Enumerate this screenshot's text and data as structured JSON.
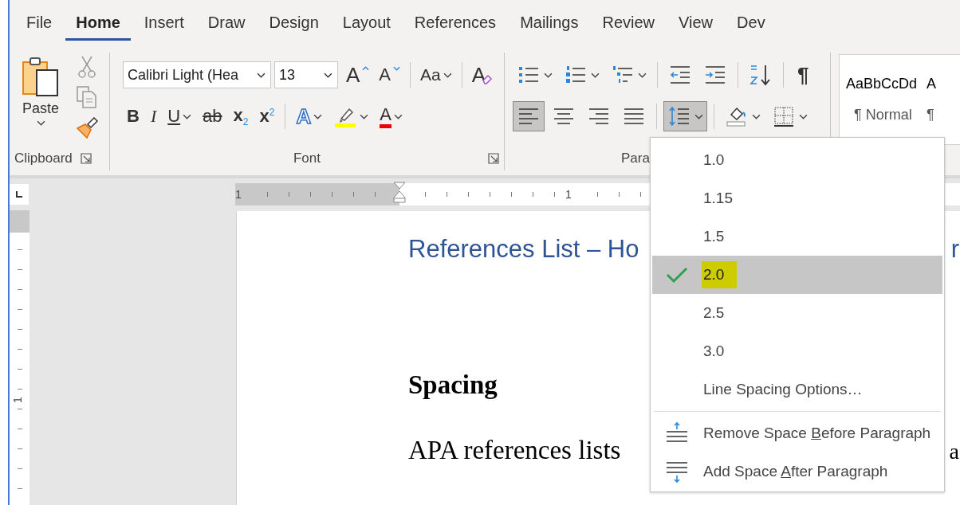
{
  "tabs": [
    {
      "label": "File",
      "selected": false
    },
    {
      "label": "Home",
      "selected": true
    },
    {
      "label": "Insert",
      "selected": false
    },
    {
      "label": "Draw",
      "selected": false
    },
    {
      "label": "Design",
      "selected": false
    },
    {
      "label": "Layout",
      "selected": false
    },
    {
      "label": "References",
      "selected": false
    },
    {
      "label": "Mailings",
      "selected": false
    },
    {
      "label": "Review",
      "selected": false
    },
    {
      "label": "View",
      "selected": false
    },
    {
      "label": "Dev",
      "selected": false
    }
  ],
  "clipboard": {
    "paste_label": "Paste",
    "group_label": "Clipboard"
  },
  "font": {
    "font_name": "Calibri Light (Hea",
    "font_size": "13",
    "group_label": "Font",
    "row1": [
      {
        "kind": "grow",
        "label": "A"
      },
      {
        "kind": "shrink",
        "label": "A"
      },
      {
        "kind": "case",
        "label": "Aa",
        "dropdown": true
      },
      {
        "kind": "clear",
        "label": "A"
      }
    ],
    "row2": [
      {
        "kind": "bold",
        "label": "B"
      },
      {
        "kind": "italic",
        "label": "I"
      },
      {
        "kind": "underline",
        "label": "U",
        "dropdown": true
      },
      {
        "kind": "strike",
        "label": "ab"
      },
      {
        "kind": "sub",
        "label": "x$_{2}$"
      },
      {
        "kind": "sup",
        "label": "x$^{2}$"
      },
      {
        "kind": "effects",
        "label": "A",
        "dropdown": true
      },
      {
        "kind": "highlight",
        "dropdown": true
      },
      {
        "kind": "color",
        "label": "A",
        "dropdown": true
      }
    ]
  },
  "paragraph": {
    "group_label": "Para",
    "row1": [
      {
        "kind": "bullets",
        "dropdown": true
      },
      {
        "kind": "numbering",
        "dropdown": true
      },
      {
        "kind": "multilevel",
        "dropdown": true
      },
      {
        "kind": "outdent"
      },
      {
        "kind": "indent"
      },
      {
        "kind": "sort"
      },
      {
        "kind": "pilcrow",
        "label": "¶"
      }
    ],
    "row2": [
      {
        "kind": "left",
        "selected": true
      },
      {
        "kind": "center",
        "selected": false
      },
      {
        "kind": "right",
        "selected": false
      },
      {
        "kind": "justify",
        "selected": false
      },
      {
        "kind": "spacing",
        "selected": true,
        "dropdown": true
      },
      {
        "kind": "shading",
        "selected": false,
        "dropdown": true
      },
      {
        "kind": "borders",
        "selected": false,
        "dropdown": true
      }
    ]
  },
  "styles": [
    {
      "preview": "AaBbCcDd",
      "name": "¶ Normal"
    },
    {
      "preview": "A",
      "name": "¶"
    }
  ],
  "ruler": {
    "h_labels": [
      "1",
      "1"
    ],
    "v_label": "1"
  },
  "document": {
    "heading": "References List – Ho",
    "heading_tail": "r",
    "subheading": "Spacing",
    "body": "APA references lists",
    "body_tail": "a"
  },
  "menu": {
    "items": [
      {
        "kind": "value",
        "label": "1.0",
        "selected": false,
        "highlighted": false
      },
      {
        "kind": "value",
        "label": "1.15",
        "selected": false,
        "highlighted": false
      },
      {
        "kind": "value",
        "label": "1.5",
        "selected": false,
        "highlighted": false
      },
      {
        "kind": "value",
        "label": "2.0",
        "selected": true,
        "highlighted": true
      },
      {
        "kind": "value",
        "label": "2.5",
        "selected": false,
        "highlighted": false
      },
      {
        "kind": "value",
        "label": "3.0",
        "selected": false,
        "highlighted": false
      },
      {
        "kind": "option",
        "label": "Line Spacing Options…"
      },
      {
        "kind": "before",
        "pre": "Remove Space ",
        "key": "B",
        "post": "efore Paragraph"
      },
      {
        "kind": "after",
        "pre": "Add Space ",
        "key": "A",
        "post": "fter Paragraph"
      }
    ]
  }
}
